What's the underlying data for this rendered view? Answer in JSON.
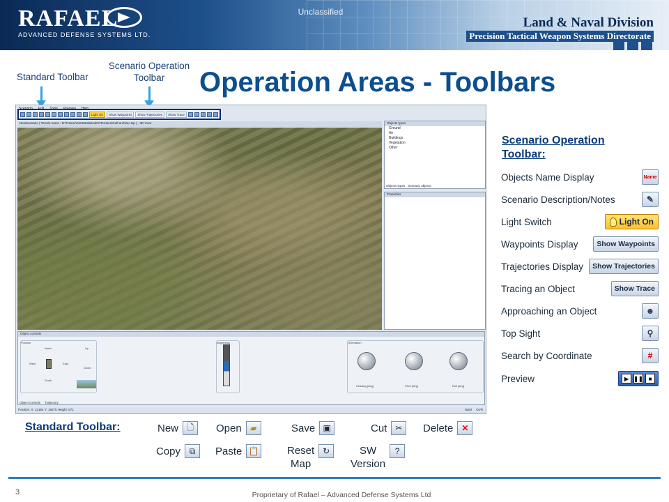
{
  "header": {
    "logo_text": "RAFAEL",
    "logo_sub": "ADVANCED DEFENSE SYSTEMS LTD.",
    "classification": "Unclassified",
    "division": "Land & Naval Division",
    "directorate": "Precision Tactical Weapon Systems Directorate"
  },
  "annotations": {
    "standard_toolbar": "Standard Toolbar",
    "scenario_toolbar_line1": "Scenario Operation",
    "scenario_toolbar_line2": "Toolbar"
  },
  "title": "Operation Areas - Toolbars",
  "app": {
    "menu": [
      "Scenario",
      "Edit",
      "Tools",
      "Preview",
      "Help"
    ],
    "toolbar_labels": [
      "Light On",
      "Show Waypoints",
      "Show Trajectories",
      "Show Trace"
    ],
    "doc_tab": "NewScenario ( Terrain name : D:\\Trainer\\SimData\\Models\\Terrains\\Golf.architec.txp ) - 3D View",
    "objects_types_title": "Objects types",
    "objects_tree": [
      "Ground",
      "Air",
      "Buildings",
      "Vegetation",
      "Other"
    ],
    "tabs_right": [
      "Objects types",
      "Scenario objects"
    ],
    "properties_title": "Properties",
    "object_controls_title": "Object controls",
    "position_label": "Position",
    "brightness_label": "Brightness",
    "orientation_label": "Orientation",
    "dial_labels": [
      "Heading [deg]",
      "Pitch [deg]",
      "Roll [deg]"
    ],
    "directions": [
      "North",
      "West",
      "East",
      "South",
      "Up",
      "Down"
    ],
    "bottom_tabs": [
      "Object controls",
      "Trajectory"
    ],
    "status": "Position: X: 12184 Y: 15575 Height: 671",
    "status_right": [
      "NUM",
      "OVR"
    ]
  },
  "scenario_toolbar": {
    "title_line1": "Scenario Operation",
    "title_line2": "Toolbar:",
    "items": [
      {
        "label": "Objects Name Display",
        "icon": "name-icon",
        "button_text": "Name"
      },
      {
        "label": "Scenario Description/Notes",
        "icon": "notes-icon",
        "button_text": ""
      },
      {
        "label": "Light Switch",
        "icon": "light-bulb-icon",
        "button_text": "Light On"
      },
      {
        "label": "Waypoints Display",
        "icon": "",
        "button_text": "Show Waypoints"
      },
      {
        "label": "Trajectories Display",
        "icon": "",
        "button_text": "Show Trajectories"
      },
      {
        "label": "Tracing an Object",
        "icon": "",
        "button_text": "Show Trace"
      },
      {
        "label": "Approaching an Object",
        "icon": "approach-icon",
        "button_text": ""
      },
      {
        "label": "Top Sight",
        "icon": "top-sight-icon",
        "button_text": ""
      },
      {
        "label": "Search by Coordinate",
        "icon": "coordinate-search-icon",
        "button_text": ""
      },
      {
        "label": "Preview",
        "icon": "preview-controls-icon",
        "button_text": ""
      }
    ]
  },
  "standard_toolbar": {
    "title": "Standard Toolbar:",
    "items": [
      {
        "label": "New",
        "icon": "new-file-icon"
      },
      {
        "label": "Open",
        "icon": "open-folder-icon"
      },
      {
        "label": "Save",
        "icon": "save-disk-icon"
      },
      {
        "label": "Cut",
        "icon": "scissors-icon"
      },
      {
        "label": "Delete",
        "icon": "delete-x-icon"
      },
      {
        "label": "Copy",
        "icon": "copy-icon"
      },
      {
        "label": "Paste",
        "icon": "paste-icon"
      },
      {
        "label_line1": "Reset",
        "label_line2": "Map",
        "icon": "reset-map-icon"
      },
      {
        "label_line1": "SW",
        "label_line2": "Version",
        "icon": "help-version-icon"
      }
    ]
  },
  "footer": {
    "page_number": "3",
    "text": "Proprietary of Rafael – Advanced Defense Systems Ltd"
  }
}
